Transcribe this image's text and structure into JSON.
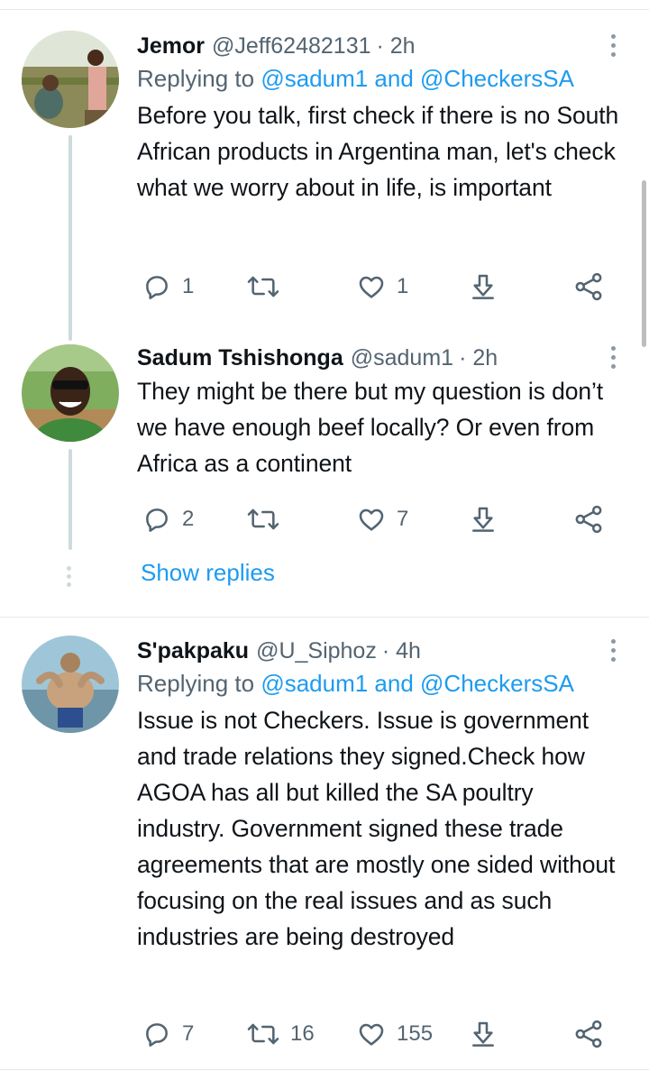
{
  "tweets": [
    {
      "name": "Jemor",
      "handle": "@Jeff62482131",
      "time": "· 2h",
      "replying_prefix": "Replying to ",
      "replying_mentions": "@sadum1 and @CheckersSA",
      "text": "Before you talk, first check if there is no South African products in Argentina man, let's check what we worry about in life, is important",
      "replies": "1",
      "retweets": "",
      "likes": "1"
    },
    {
      "name": "Sadum Tshishonga",
      "handle": "@sadum1",
      "time": "· 2h",
      "text": "They might be there but my question is don’t we have enough beef locally? Or even from Africa as a continent",
      "replies": "2",
      "retweets": "",
      "likes": "7"
    },
    {
      "name": "S'pakpaku",
      "handle": "@U_Siphoz",
      "time": "· 4h",
      "replying_prefix": "Replying to ",
      "replying_mentions": "@sadum1 and @CheckersSA",
      "text": "Issue is not Checkers. Issue is government and trade relations they signed.Check how AGOA has all but killed the SA poultry industry. Government signed these trade agreements that are mostly one sided without focusing on the real issues and as such industries are being destroyed",
      "replies": "7",
      "retweets": "16",
      "likes": "155"
    }
  ],
  "show_replies_label": "Show replies",
  "icons": {
    "reply": "reply-icon",
    "retweet": "retweet-icon",
    "like": "heart-icon",
    "download": "download-icon",
    "share": "share-icon",
    "more": "more-vertical-icon"
  },
  "colors": {
    "accent": "#1d9bf0",
    "muted": "#536471",
    "text": "#0f1419",
    "thread_line": "#cfd9de"
  }
}
